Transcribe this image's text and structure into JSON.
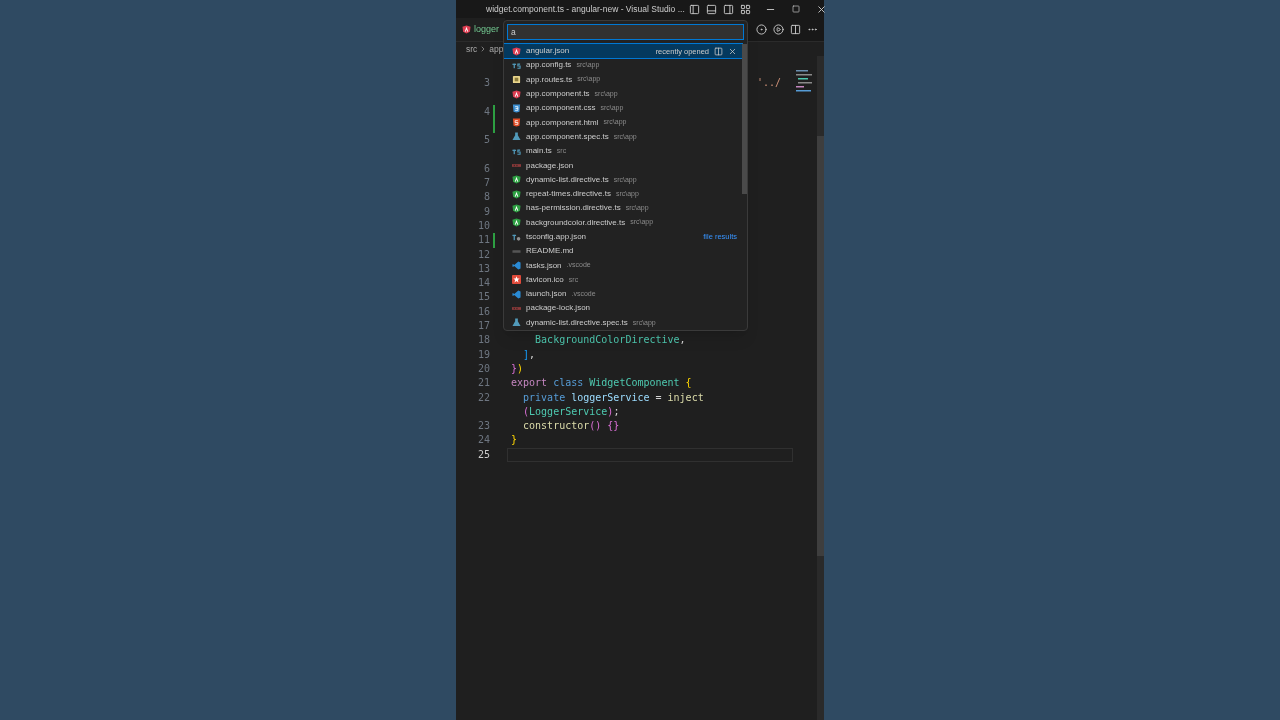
{
  "window": {
    "title": "widget.component.ts - angular-new - Visual Studio ..."
  },
  "tab": {
    "label": "logger"
  },
  "breadcrumb": [
    "src",
    "app"
  ],
  "editor": {
    "lines": [
      {
        "number": "3",
        "kind": "wrapped",
        "changed": false,
        "active": false,
        "tail": "'../"
      },
      {
        "number": "4",
        "kind": "wrapped",
        "changed": true,
        "active": false
      },
      {
        "number": "5",
        "kind": "wrapped",
        "changed": false,
        "active": false
      },
      {
        "number": "6",
        "kind": "plain",
        "changed": false,
        "active": false
      },
      {
        "number": "7",
        "kind": "plain",
        "changed": false,
        "active": false
      },
      {
        "number": "8",
        "kind": "plain",
        "changed": false,
        "active": false
      },
      {
        "number": "9",
        "kind": "plain",
        "changed": false,
        "active": false
      },
      {
        "number": "10",
        "kind": "plain",
        "changed": false,
        "active": false
      },
      {
        "number": "11",
        "kind": "plain",
        "changed": true,
        "active": false
      },
      {
        "number": "12",
        "kind": "plain",
        "changed": false,
        "active": false
      },
      {
        "number": "13",
        "kind": "plain",
        "changed": false,
        "active": false
      },
      {
        "number": "14",
        "kind": "plain",
        "changed": false,
        "active": false
      },
      {
        "number": "15",
        "kind": "plain",
        "changed": false,
        "active": false
      },
      {
        "number": "16",
        "kind": "plain",
        "changed": false,
        "active": false
      },
      {
        "number": "17",
        "kind": "plain",
        "changed": false,
        "active": false
      },
      {
        "number": "18",
        "kind": "plain",
        "changed": false,
        "active": false,
        "code": [
          {
            "text": "    BackgroundColorDirective",
            "kind": "type"
          },
          {
            "text": ",",
            "kind": "punct"
          }
        ]
      },
      {
        "number": "19",
        "kind": "plain",
        "changed": false,
        "active": false,
        "code": [
          {
            "text": "  ]",
            "kind": "bracket3"
          },
          {
            "text": ",",
            "kind": "punct"
          }
        ]
      },
      {
        "number": "20",
        "kind": "plain",
        "changed": false,
        "active": false,
        "code": [
          {
            "text": "}",
            "kind": "bracket2"
          },
          {
            "text": ")",
            "kind": "bracket1"
          }
        ]
      },
      {
        "number": "21",
        "kind": "plain",
        "changed": false,
        "active": false,
        "code": [
          {
            "text": "export ",
            "kind": "control"
          },
          {
            "text": "class ",
            "kind": "keyword"
          },
          {
            "text": "WidgetComponent ",
            "kind": "type"
          },
          {
            "text": "{",
            "kind": "bracket1"
          }
        ]
      },
      {
        "number": "22",
        "kind": "plain",
        "changed": false,
        "active": false,
        "code": [
          {
            "text": "  private ",
            "kind": "keyword"
          },
          {
            "text": "loggerService ",
            "kind": "variable"
          },
          {
            "text": "= ",
            "kind": "punct"
          },
          {
            "text": "inject",
            "kind": "function"
          }
        ],
        "continuation": [
          {
            "text": "  (",
            "kind": "bracket2"
          },
          {
            "text": "LoggerService",
            "kind": "type"
          },
          {
            "text": ")",
            "kind": "bracket2"
          },
          {
            "text": ";",
            "kind": "punct"
          }
        ]
      },
      {
        "number": "23",
        "kind": "plain",
        "changed": false,
        "active": false,
        "code": [
          {
            "text": "  constructor",
            "kind": "function"
          },
          {
            "text": "() {}",
            "kind": "bracket2"
          }
        ]
      },
      {
        "number": "24",
        "kind": "plain",
        "changed": false,
        "active": false,
        "code": [
          {
            "text": "}",
            "kind": "bracket1"
          }
        ]
      },
      {
        "number": "25",
        "kind": "plain",
        "changed": false,
        "active": true
      }
    ]
  },
  "quick_open": {
    "value": "a",
    "items": [
      {
        "name": "angular.json",
        "kind": "angular",
        "selected": true,
        "note": "recently opened"
      },
      {
        "name": "app.config.ts",
        "path": "src\\app",
        "kind": "ts",
        "selected": false
      },
      {
        "name": "app.routes.ts",
        "path": "src\\app",
        "kind": "routes",
        "selected": false
      },
      {
        "name": "app.component.ts",
        "path": "src\\app",
        "kind": "angular",
        "selected": false
      },
      {
        "name": "app.component.css",
        "path": "src\\app",
        "kind": "css",
        "selected": false
      },
      {
        "name": "app.component.html",
        "path": "src\\app",
        "kind": "html",
        "selected": false
      },
      {
        "name": "app.component.spec.ts",
        "path": "src\\app",
        "kind": "spec",
        "selected": false
      },
      {
        "name": "main.ts",
        "path": "src",
        "kind": "ts",
        "selected": false
      },
      {
        "name": "package.json",
        "kind": "npm",
        "selected": false
      },
      {
        "name": "dynamic-list.directive.ts",
        "path": "src\\app",
        "kind": "directive",
        "selected": false
      },
      {
        "name": "repeat-times.directive.ts",
        "path": "src\\app",
        "kind": "directive",
        "selected": false
      },
      {
        "name": "has-permission.directive.ts",
        "path": "src\\app",
        "kind": "directive",
        "selected": false
      },
      {
        "name": "backgroundcolor.directive.ts",
        "path": "src\\app",
        "kind": "directive",
        "selected": false
      },
      {
        "name": "tsconfig.app.json",
        "kind": "tsconfig",
        "selected": false,
        "note": "file results"
      },
      {
        "name": "README.md",
        "kind": "readme",
        "selected": false
      },
      {
        "name": "tasks.json",
        "path": ".vscode",
        "kind": "vscode",
        "selected": false
      },
      {
        "name": "favicon.ico",
        "path": "src",
        "kind": "favicon",
        "selected": false
      },
      {
        "name": "launch.json",
        "path": ".vscode",
        "kind": "vscode",
        "selected": false
      },
      {
        "name": "package-lock.json",
        "kind": "npm",
        "selected": false
      },
      {
        "name": "dynamic-list.directive.spec.ts",
        "path": "src\\app",
        "kind": "spec",
        "selected": false
      }
    ]
  }
}
